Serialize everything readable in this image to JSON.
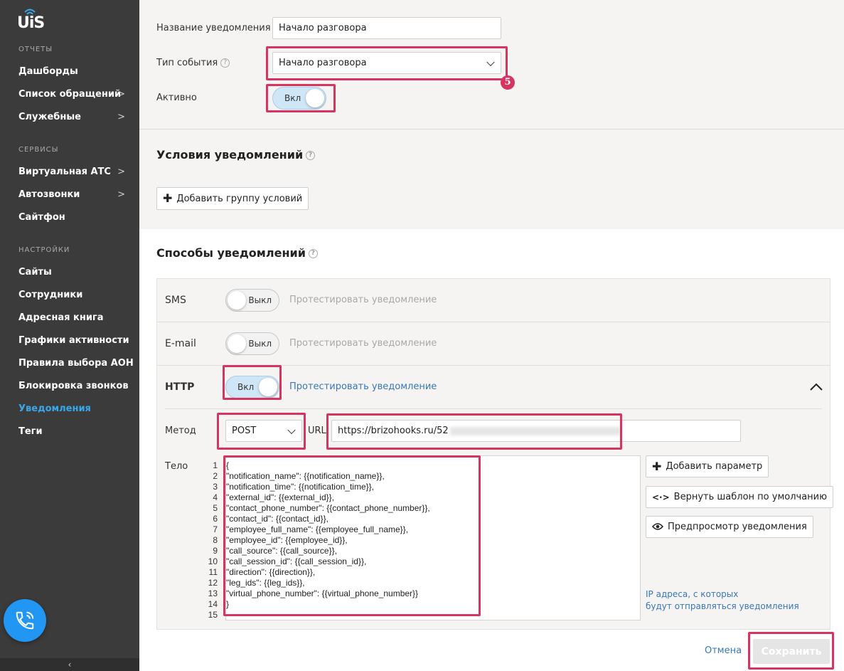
{
  "brand": {
    "logo_text": "UiS"
  },
  "sidebar": {
    "sections": [
      {
        "title": "ОТЧЕТЫ"
      },
      {
        "title": "СЕРВИСЫ"
      },
      {
        "title": "НАСТРОЙКИ"
      }
    ],
    "items": [
      {
        "label": "Дашборды"
      },
      {
        "label": "Список обращений",
        "arrow": ">"
      },
      {
        "label": "Служебные",
        "arrow": ">"
      },
      {
        "label": "Виртуальная АТС",
        "arrow": ">"
      },
      {
        "label": "Автозвонки",
        "arrow": ">"
      },
      {
        "label": "Сайтфон"
      },
      {
        "label": "Сайты"
      },
      {
        "label": "Сотрудники"
      },
      {
        "label": "Адресная книга"
      },
      {
        "label": "Графики активности"
      },
      {
        "label": "Правила выбора АОН"
      },
      {
        "label": "Блокировка звонков"
      },
      {
        "label": "Уведомления",
        "active": true
      },
      {
        "label": "Теги"
      }
    ],
    "collapse_glyph": "‹"
  },
  "form": {
    "name_label": "Название уведомления",
    "name_value": "Начало разговора",
    "event_label": "Тип события",
    "event_value": "Начало разговора",
    "active_label": "Активно",
    "active_toggle": "Вкл",
    "help_glyph": "?",
    "annotation_number": "5"
  },
  "conditions": {
    "title": "Условия уведомлений",
    "add_group": "Добавить группу условий"
  },
  "methods": {
    "title": "Способы уведомлений",
    "sms": {
      "label": "SMS",
      "toggle": "Выкл",
      "test": "Протестировать уведомление"
    },
    "email": {
      "label": "E-mail",
      "toggle": "Выкл",
      "test": "Протестировать уведомление"
    },
    "http": {
      "label": "HTTP",
      "toggle": "Вкл",
      "test": "Протестировать уведомление",
      "method_label": "Метод",
      "method_value": "POST",
      "url_label": "URL",
      "url_value": "https://brizohooks.ru/52",
      "body_label": "Тело",
      "body_lines": [
        "{",
        "\"notification_name\": {{notification_name}},",
        "\"notification_time\": {{notification_time}},",
        "\"external_id\": {{external_id}},",
        "\"contact_phone_number\": {{contact_phone_number}},",
        "\"contact_id\": {{contact_id}},",
        "\"employee_full_name\": {{employee_full_name}},",
        "\"employee_id\": {{employee_id}},",
        "\"call_source\": {{call_source}},",
        "\"call_session_id\": {{call_session_id}},",
        "\"direction\": {{direction}},",
        "\"leg_ids\": {{leg_ids}},",
        "\"virtual_phone_number\": {{virtual_phone_number}}",
        "}",
        ""
      ],
      "add_param": "Добавить параметр",
      "reset_template": "Вернуть шаблон по умолчанию",
      "preview": "Предпросмотр уведомления",
      "ip_link_line1": "IP адреса, с которых",
      "ip_link_line2": "будут отправляться уведомления"
    }
  },
  "footer": {
    "cancel": "Отмена",
    "save": "Сохранить"
  },
  "colors": {
    "accent": "#3aa7e8",
    "highlight": "#d63461",
    "link": "#3a78b5",
    "sidebar_bg": "#3b3b3b"
  }
}
